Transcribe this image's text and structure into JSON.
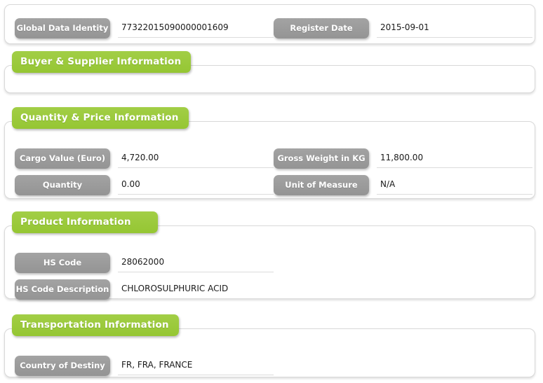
{
  "sections": [
    {
      "id": "identity",
      "title": null,
      "fields": [
        {
          "label": "Global Data Identity",
          "value": "77322015090000001609",
          "width": "w-std",
          "col": "left",
          "row": 0
        },
        {
          "label": "Register Date",
          "value": "2015-09-01",
          "width": "w-std",
          "col": "right",
          "row": 0
        }
      ]
    },
    {
      "id": "buyer-supplier",
      "title": "Buyer & Supplier Information",
      "fields": []
    },
    {
      "id": "quantity-price",
      "title": "Quantity & Price Information",
      "fields": [
        {
          "label": "Cargo Value (Euro)",
          "value": "4,720.00",
          "width": "w-std",
          "col": "left",
          "row": 0
        },
        {
          "label": "Gross Weight in KG",
          "value": "11,800.00",
          "width": "w-std",
          "col": "right",
          "row": 0
        },
        {
          "label": "Quantity",
          "value": "0.00",
          "width": "w-std",
          "col": "left",
          "row": 1
        },
        {
          "label": "Unit of Measure",
          "value": "N/A",
          "width": "w-std",
          "col": "right",
          "row": 1
        }
      ]
    },
    {
      "id": "product",
      "title": "Product Information",
      "fields": [
        {
          "label": "HS Code",
          "value": "28062000",
          "width": "w-std",
          "col": "left",
          "row": 0
        },
        {
          "label": "HS Code Description",
          "value": "CHLOROSULPHURIC ACID",
          "width": "w-wide",
          "col": "left",
          "row": 1
        }
      ]
    },
    {
      "id": "transportation",
      "title": "Transportation Information",
      "fields": [
        {
          "label": "Country of Destiny",
          "value": "FR, FRA, FRANCE",
          "width": "w-std",
          "col": "left",
          "row": 0
        }
      ]
    }
  ],
  "colors": {
    "accent_green": "#9ACA3C",
    "label_gray": "#9B9B9B",
    "panel_border": "#D9D9D9",
    "underline": "#DCDCDC",
    "value_text": "#1A1A1A",
    "page_background": "#FFFFFF"
  }
}
